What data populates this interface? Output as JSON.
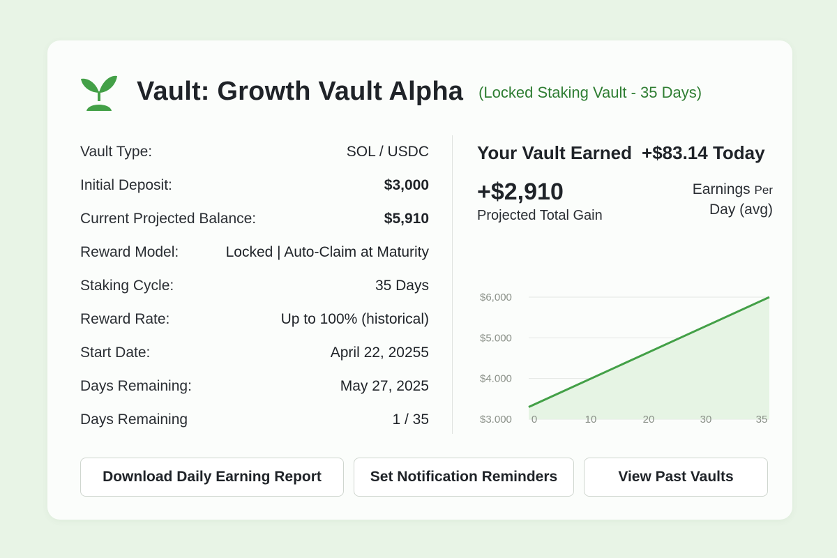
{
  "header": {
    "title": "Vault: Growth Vault Alpha",
    "subtitle": "(Locked Staking Vault - 35 Days)",
    "icon": "sprout-icon"
  },
  "details": [
    {
      "label": "Vault Type:",
      "value": "SOL / USDC",
      "bold": false
    },
    {
      "label": "Initial Deposit:",
      "value": "$3,000",
      "bold": true
    },
    {
      "label": "Current Projected Balance:",
      "value": "$5,910",
      "bold": true
    },
    {
      "label": "Reward Model:",
      "value": "Locked | Auto-Claim at Maturity",
      "bold": false
    },
    {
      "label": "Staking Cycle:",
      "value": "35 Days",
      "bold": false
    },
    {
      "label": "Reward Rate:",
      "value": "Up to 100% (historical)",
      "bold": false
    },
    {
      "label": "Start Date:",
      "value": "April 22, 20255",
      "bold": false
    },
    {
      "label": "Days Remaining:",
      "value": "May 27, 2025",
      "bold": false
    },
    {
      "label": "Days Remaining",
      "value": "1 / 35",
      "bold": false
    }
  ],
  "summary": {
    "earned_label": "Your Vault Earned",
    "earned_amount": "+$83.14 Today",
    "total_gain": "+$2,910",
    "total_gain_label": "Projected Total Gain",
    "per_day_line1": "Earnings",
    "per_day_small": "Per",
    "per_day_line2": "Day (avg)"
  },
  "chart_data": {
    "type": "area",
    "x": [
      0,
      35
    ],
    "y": [
      3300,
      6000
    ],
    "xticks": [
      "0",
      "10",
      "20",
      "30",
      "35"
    ],
    "xtick_values": [
      0,
      10,
      20,
      30,
      35
    ],
    "yticks": [
      "$6,000",
      "$5.000",
      "$4.000",
      "$3.000"
    ],
    "ytick_values": [
      6000,
      5000,
      4000,
      3000
    ],
    "xlim": [
      0,
      35
    ],
    "ylim": [
      3000,
      6000
    ],
    "grid": true,
    "line_color": "#43a047",
    "fill_color": "#e6f4e4"
  },
  "buttons": {
    "download": "Download Daily Earning Report",
    "notify": "Set Notification Reminders",
    "past": "View Past Vaults"
  },
  "colors": {
    "accent": "#2e7d32",
    "background": "#e8f4e6"
  }
}
